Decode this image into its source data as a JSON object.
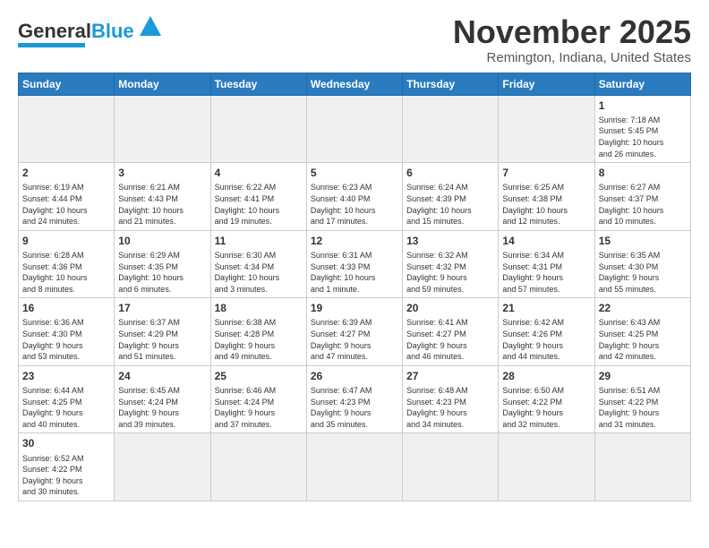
{
  "header": {
    "logo_main": "General",
    "logo_accent": "Blue",
    "title": "November 2025",
    "subtitle": "Remington, Indiana, United States"
  },
  "weekdays": [
    "Sunday",
    "Monday",
    "Tuesday",
    "Wednesday",
    "Thursday",
    "Friday",
    "Saturday"
  ],
  "weeks": [
    [
      {
        "day": "",
        "info": ""
      },
      {
        "day": "",
        "info": ""
      },
      {
        "day": "",
        "info": ""
      },
      {
        "day": "",
        "info": ""
      },
      {
        "day": "",
        "info": ""
      },
      {
        "day": "",
        "info": ""
      },
      {
        "day": "1",
        "info": "Sunrise: 7:18 AM\nSunset: 5:45 PM\nDaylight: 10 hours\nand 26 minutes."
      }
    ],
    [
      {
        "day": "2",
        "info": "Sunrise: 6:19 AM\nSunset: 4:44 PM\nDaylight: 10 hours\nand 24 minutes."
      },
      {
        "day": "3",
        "info": "Sunrise: 6:21 AM\nSunset: 4:43 PM\nDaylight: 10 hours\nand 21 minutes."
      },
      {
        "day": "4",
        "info": "Sunrise: 6:22 AM\nSunset: 4:41 PM\nDaylight: 10 hours\nand 19 minutes."
      },
      {
        "day": "5",
        "info": "Sunrise: 6:23 AM\nSunset: 4:40 PM\nDaylight: 10 hours\nand 17 minutes."
      },
      {
        "day": "6",
        "info": "Sunrise: 6:24 AM\nSunset: 4:39 PM\nDaylight: 10 hours\nand 15 minutes."
      },
      {
        "day": "7",
        "info": "Sunrise: 6:25 AM\nSunset: 4:38 PM\nDaylight: 10 hours\nand 12 minutes."
      },
      {
        "day": "8",
        "info": "Sunrise: 6:27 AM\nSunset: 4:37 PM\nDaylight: 10 hours\nand 10 minutes."
      }
    ],
    [
      {
        "day": "9",
        "info": "Sunrise: 6:28 AM\nSunset: 4:36 PM\nDaylight: 10 hours\nand 8 minutes."
      },
      {
        "day": "10",
        "info": "Sunrise: 6:29 AM\nSunset: 4:35 PM\nDaylight: 10 hours\nand 6 minutes."
      },
      {
        "day": "11",
        "info": "Sunrise: 6:30 AM\nSunset: 4:34 PM\nDaylight: 10 hours\nand 3 minutes."
      },
      {
        "day": "12",
        "info": "Sunrise: 6:31 AM\nSunset: 4:33 PM\nDaylight: 10 hours\nand 1 minute."
      },
      {
        "day": "13",
        "info": "Sunrise: 6:32 AM\nSunset: 4:32 PM\nDaylight: 9 hours\nand 59 minutes."
      },
      {
        "day": "14",
        "info": "Sunrise: 6:34 AM\nSunset: 4:31 PM\nDaylight: 9 hours\nand 57 minutes."
      },
      {
        "day": "15",
        "info": "Sunrise: 6:35 AM\nSunset: 4:30 PM\nDaylight: 9 hours\nand 55 minutes."
      }
    ],
    [
      {
        "day": "16",
        "info": "Sunrise: 6:36 AM\nSunset: 4:30 PM\nDaylight: 9 hours\nand 53 minutes."
      },
      {
        "day": "17",
        "info": "Sunrise: 6:37 AM\nSunset: 4:29 PM\nDaylight: 9 hours\nand 51 minutes."
      },
      {
        "day": "18",
        "info": "Sunrise: 6:38 AM\nSunset: 4:28 PM\nDaylight: 9 hours\nand 49 minutes."
      },
      {
        "day": "19",
        "info": "Sunrise: 6:39 AM\nSunset: 4:27 PM\nDaylight: 9 hours\nand 47 minutes."
      },
      {
        "day": "20",
        "info": "Sunrise: 6:41 AM\nSunset: 4:27 PM\nDaylight: 9 hours\nand 46 minutes."
      },
      {
        "day": "21",
        "info": "Sunrise: 6:42 AM\nSunset: 4:26 PM\nDaylight: 9 hours\nand 44 minutes."
      },
      {
        "day": "22",
        "info": "Sunrise: 6:43 AM\nSunset: 4:25 PM\nDaylight: 9 hours\nand 42 minutes."
      }
    ],
    [
      {
        "day": "23",
        "info": "Sunrise: 6:44 AM\nSunset: 4:25 PM\nDaylight: 9 hours\nand 40 minutes."
      },
      {
        "day": "24",
        "info": "Sunrise: 6:45 AM\nSunset: 4:24 PM\nDaylight: 9 hours\nand 39 minutes."
      },
      {
        "day": "25",
        "info": "Sunrise: 6:46 AM\nSunset: 4:24 PM\nDaylight: 9 hours\nand 37 minutes."
      },
      {
        "day": "26",
        "info": "Sunrise: 6:47 AM\nSunset: 4:23 PM\nDaylight: 9 hours\nand 35 minutes."
      },
      {
        "day": "27",
        "info": "Sunrise: 6:48 AM\nSunset: 4:23 PM\nDaylight: 9 hours\nand 34 minutes."
      },
      {
        "day": "28",
        "info": "Sunrise: 6:50 AM\nSunset: 4:22 PM\nDaylight: 9 hours\nand 32 minutes."
      },
      {
        "day": "29",
        "info": "Sunrise: 6:51 AM\nSunset: 4:22 PM\nDaylight: 9 hours\nand 31 minutes."
      }
    ],
    [
      {
        "day": "30",
        "info": "Sunrise: 6:52 AM\nSunset: 4:22 PM\nDaylight: 9 hours\nand 30 minutes."
      },
      {
        "day": "",
        "info": ""
      },
      {
        "day": "",
        "info": ""
      },
      {
        "day": "",
        "info": ""
      },
      {
        "day": "",
        "info": ""
      },
      {
        "day": "",
        "info": ""
      },
      {
        "day": "",
        "info": ""
      }
    ]
  ]
}
